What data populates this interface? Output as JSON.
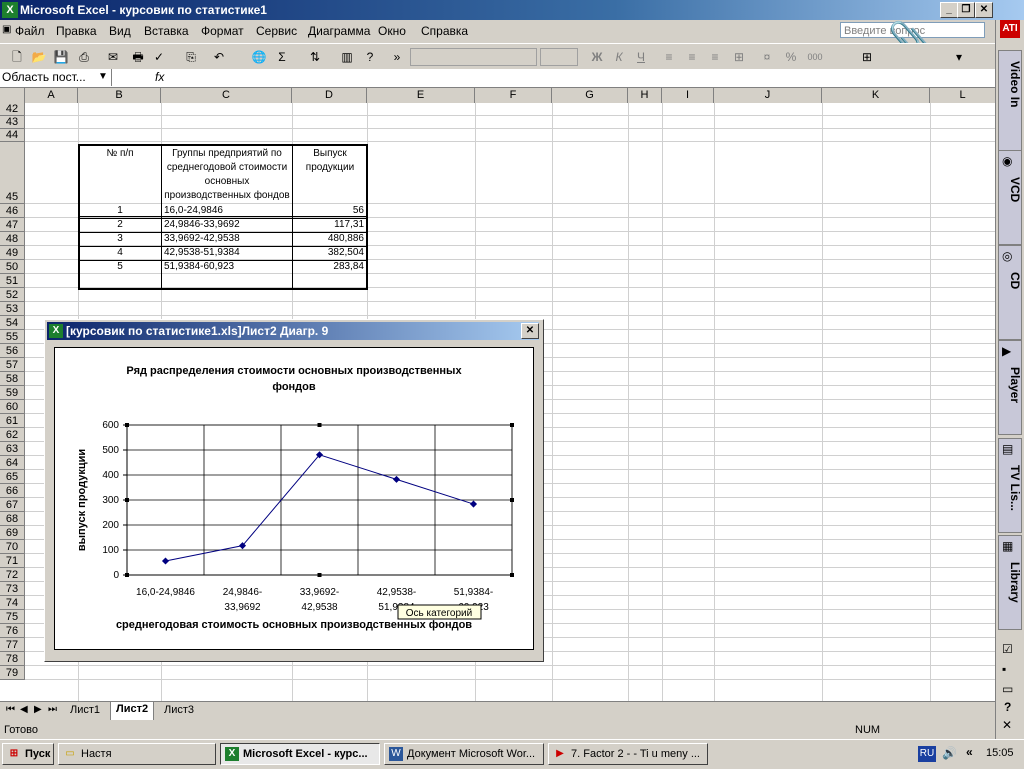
{
  "window": {
    "title": "Microsoft Excel - курсовик  по статистике1"
  },
  "menu": [
    "Файл",
    "Правка",
    "Вид",
    "Вставка",
    "Формат",
    "Сервис",
    "Диаграмма",
    "Окно",
    "Справка"
  ],
  "ask_placeholder": "Введите вопрос",
  "formula": {
    "name_box": "Область пост...",
    "fx": "fx"
  },
  "columns": [
    "A",
    "B",
    "C",
    "D",
    "E",
    "F",
    "G",
    "H",
    "I",
    "J",
    "K",
    "L"
  ],
  "rows": [
    "42",
    "43",
    "44",
    "45",
    "46",
    "47",
    "48",
    "49",
    "50",
    "51",
    "52",
    "53",
    "54",
    "55",
    "56",
    "57",
    "58",
    "59",
    "60",
    "61",
    "62",
    "63",
    "64",
    "65",
    "66",
    "67",
    "68",
    "69",
    "70",
    "71",
    "72",
    "73",
    "74",
    "75",
    "76",
    "77",
    "78",
    "79"
  ],
  "table": {
    "headers": [
      "№ п/п",
      "Группы  предприятий по среднегодовой стоимости основных производственных фондов",
      "Выпуск продукции"
    ],
    "rows": [
      [
        "1",
        "16,0-24,9846",
        "56"
      ],
      [
        "2",
        "24,9846-33,9692",
        "117,31"
      ],
      [
        "3",
        "33,9692-42,9538",
        "480,886"
      ],
      [
        "4",
        "42,9538-51,9384",
        "382,504"
      ],
      [
        "5",
        "51,9384-60,923",
        "283,84"
      ]
    ]
  },
  "chart_window": {
    "title": "[курсовик  по статистике1.xls]Лист2 Диагр. 9"
  },
  "chart_data": {
    "type": "line",
    "title": "Ряд распределения стоимости  основных  производственных фондов",
    "xlabel": "среднегодовая стоимость основных производственных  фондов",
    "ylabel": "выпуск продукции",
    "categories": [
      "16,0-24,9846",
      "24,9846-33,9692",
      "33,9692-42,9538",
      "42,9538-51,9384",
      "51,9384-60,923"
    ],
    "category_lines": [
      [
        "16,0-24,9846",
        ""
      ],
      [
        "24,9846-",
        "33,9692"
      ],
      [
        "33,9692-",
        "42,9538"
      ],
      [
        "42,9538-",
        "51,9384"
      ],
      [
        "51,9384-",
        "60,923"
      ]
    ],
    "values": [
      56,
      117.31,
      480.886,
      382.504,
      283.84
    ],
    "yticks": [
      "0",
      "100",
      "200",
      "300",
      "400",
      "500",
      "600"
    ],
    "ylim": [
      0,
      600
    ],
    "grid": true,
    "color": "#000080",
    "tooltip": "Ось категорий"
  },
  "sheet_tabs": [
    "Лист1",
    "Лист2",
    "Лист3"
  ],
  "active_tab": "Лист2",
  "status": {
    "left": "Готово",
    "num": "NUM"
  },
  "taskbar": {
    "start": "Пуск",
    "items": [
      "Настя",
      "Microsoft Excel - курс...",
      "Документ Microsoft Wor...",
      "7. Factor 2 - - Ti u meny ..."
    ],
    "lang": "RU",
    "clock": "15:05"
  },
  "sidebar": [
    "Video In",
    "VCD",
    "CD",
    "Player",
    "TV Lis...",
    "Library"
  ]
}
